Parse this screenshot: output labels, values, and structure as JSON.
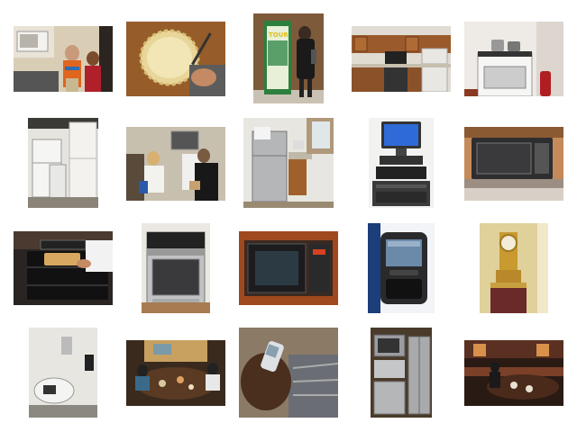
{
  "gallery": {
    "tiles": [
      {
        "subject": "kitchen-children-microwave"
      },
      {
        "subject": "pie-crust"
      },
      {
        "subject": "tour-kiosk"
      },
      {
        "subject": "wooden-kitchen"
      },
      {
        "subject": "white-gas-stove"
      },
      {
        "subject": "white-fridge-corner"
      },
      {
        "subject": "people-kitchen"
      },
      {
        "subject": "steel-fridge-kitchen"
      },
      {
        "subject": "computer-monitor"
      },
      {
        "subject": "black-microwave"
      },
      {
        "subject": "oven-tray"
      },
      {
        "subject": "steel-range"
      },
      {
        "subject": "wall-microwave"
      },
      {
        "subject": "smartphone"
      },
      {
        "subject": "gold-clock"
      },
      {
        "subject": "toilet-bathroom"
      },
      {
        "subject": "group-meal"
      },
      {
        "subject": "phone-in-hand"
      },
      {
        "subject": "steel-kitchen"
      },
      {
        "subject": "dining-room"
      }
    ],
    "tour_sign": "TOUR"
  }
}
